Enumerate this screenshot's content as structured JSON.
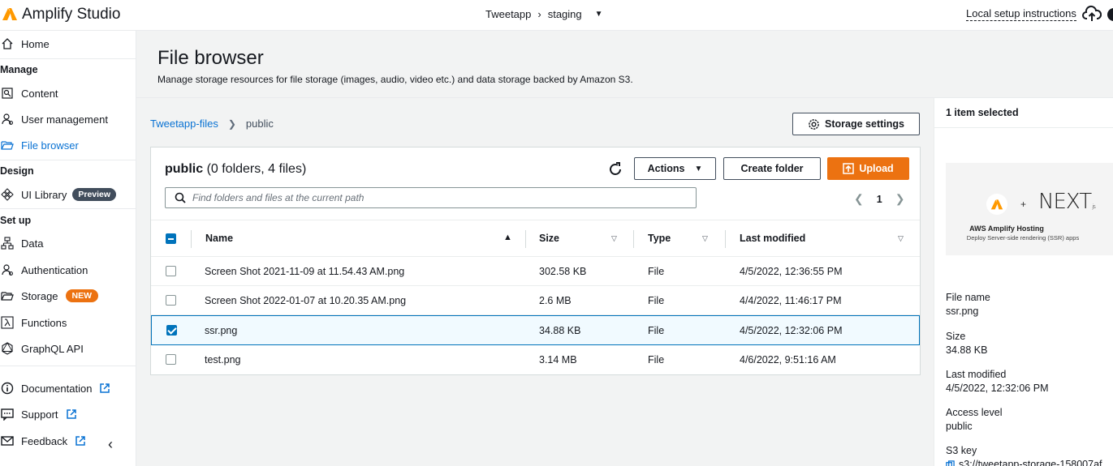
{
  "app": {
    "title": "Amplify Studio"
  },
  "env": {
    "app_name": "Tweetapp",
    "branch": "staging"
  },
  "topbar": {
    "local_setup": "Local setup instructions"
  },
  "sidebar": {
    "home": "Home",
    "manage_heading": "Manage",
    "content": "Content",
    "user_management": "User management",
    "file_browser": "File browser",
    "design_heading": "Design",
    "ui_library": "UI Library",
    "ui_library_badge": "Preview",
    "setup_heading": "Set up",
    "data": "Data",
    "authentication": "Authentication",
    "storage": "Storage",
    "storage_badge": "NEW",
    "functions": "Functions",
    "graphql": "GraphQL API",
    "documentation": "Documentation",
    "support": "Support",
    "feedback": "Feedback"
  },
  "header": {
    "title": "File browser",
    "subtitle": "Manage storage resources for file storage (images, audio, video etc.) and data storage backed by Amazon S3."
  },
  "breadcrumb": {
    "root": "Tweetapp-files",
    "current": "public"
  },
  "storage_settings_label": "Storage settings",
  "panel": {
    "folder": "public",
    "counts": "(0 folders, 4 files)",
    "actions_label": "Actions",
    "create_folder_label": "Create folder",
    "upload_label": "Upload",
    "search_placeholder": "Find folders and files at the current path",
    "page": "1"
  },
  "table": {
    "columns": {
      "name": "Name",
      "size": "Size",
      "type": "Type",
      "modified": "Last modified"
    },
    "rows": [
      {
        "name": "Screen Shot 2021-11-09 at 11.54.43 AM.png",
        "size": "302.58 KB",
        "type": "File",
        "modified": "4/5/2022, 12:36:55 PM",
        "selected": false
      },
      {
        "name": "Screen Shot 2022-01-07 at 10.20.35 AM.png",
        "size": "2.6 MB",
        "type": "File",
        "modified": "4/4/2022, 11:46:17 PM",
        "selected": false
      },
      {
        "name": "ssr.png",
        "size": "34.88 KB",
        "type": "File",
        "modified": "4/5/2022, 12:32:06 PM",
        "selected": true
      },
      {
        "name": "test.png",
        "size": "3.14 MB",
        "type": "File",
        "modified": "4/6/2022, 9:51:16 AM",
        "selected": false
      }
    ]
  },
  "detail": {
    "heading": "1 item selected",
    "preview_title": "AWS Amplify Hosting",
    "preview_subtitle": "Deploy Server-side rendering (SSR) apps",
    "preview_next_text": "NEXT",
    "preview_next_suffix": ".js",
    "file_name_label": "File name",
    "file_name": "ssr.png",
    "size_label": "Size",
    "size": "34.88 KB",
    "modified_label": "Last modified",
    "modified": "4/5/2022, 12:32:06 PM",
    "access_label": "Access level",
    "access": "public",
    "s3_label": "S3 key",
    "s3_value": "s3://tweetapp-storage-158007af"
  },
  "colors": {
    "accent": "#0972d3",
    "primary_button": "#ec7211",
    "selected_row_bg": "#f1faff"
  }
}
